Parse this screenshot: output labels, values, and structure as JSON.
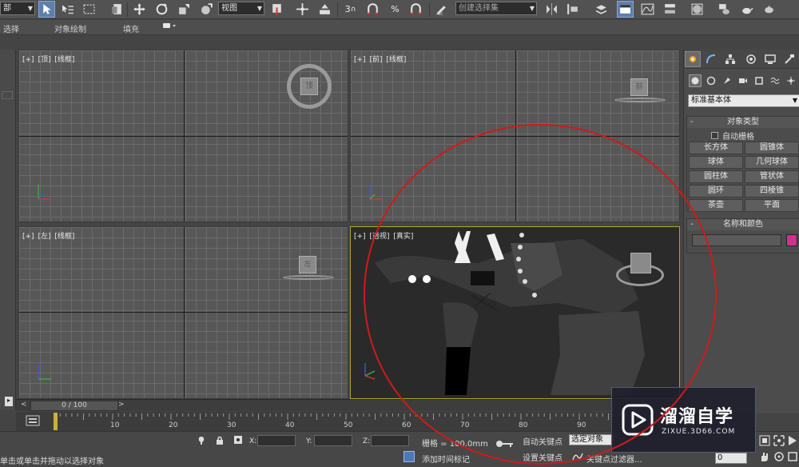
{
  "toolbar": {
    "left_dropdown": "部",
    "reference_coord": "视图",
    "selection_set_placeholder": "创建选择集",
    "snap_3": "3",
    "percent_snap": "%",
    "spinner_snap": "n"
  },
  "ribbon": {
    "items": [
      "选择",
      "对象绘制",
      "填充"
    ]
  },
  "viewports": {
    "top": {
      "labels": [
        "[+]",
        "[顶]",
        "[线框]"
      ],
      "cube": "顶"
    },
    "front": {
      "labels": [
        "[+]",
        "[前]",
        "[线框]"
      ],
      "cube": "前"
    },
    "left": {
      "labels": [
        "[+]",
        "[左]",
        "[线框]"
      ],
      "cube": "左"
    },
    "perspective": {
      "labels": [
        "[+]",
        "[透视]",
        "[真实]"
      ]
    }
  },
  "command_panel": {
    "category_dropdown": "标准基本体",
    "object_type": {
      "title": "对象类型",
      "auto_grid": "自动栅格",
      "buttons": [
        "长方体",
        "圆锥体",
        "球体",
        "几何球体",
        "圆柱体",
        "管状体",
        "圆环",
        "四棱锥",
        "茶壶",
        "平面"
      ]
    },
    "name_color": {
      "title": "名称和颜色",
      "swatch_color": "#d3308e"
    }
  },
  "timeline": {
    "frame_counter": "0 / 100",
    "ticks": [
      "10",
      "20",
      "30",
      "40",
      "50",
      "60",
      "70",
      "80",
      "90"
    ]
  },
  "status": {
    "x_label": "X:",
    "y_label": "Y:",
    "z_label": "Z:",
    "grid": "栅格 = 100.0mm",
    "auto_key": "自动关键点",
    "selected_dropdown": "选定对象",
    "set_key": "设置关键点",
    "key_filters": "关键点过滤器...",
    "add_time_tag": "添加时间标记",
    "prompt": "单击或单击并拖动以选择对象",
    "frame_value": "0"
  },
  "watermark": {
    "main": "溜溜自学",
    "sub": "ZIXUE.3D66.COM"
  },
  "colors": {
    "annotation_red": "#d01a1a",
    "active_border": "#b99b3a"
  }
}
